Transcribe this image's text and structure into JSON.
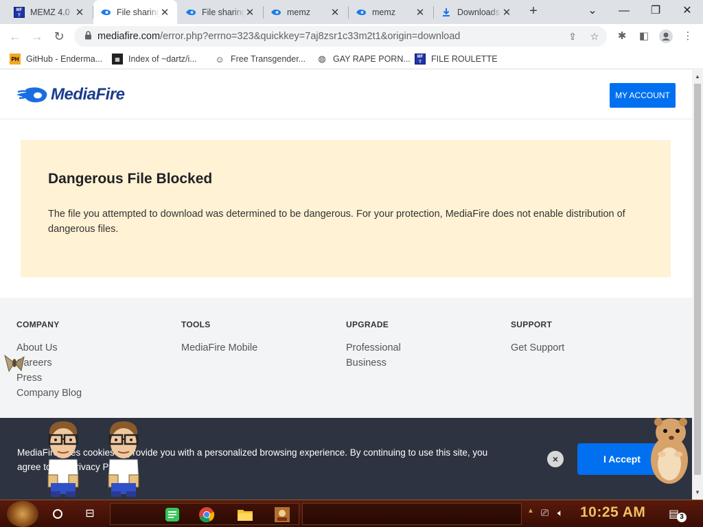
{
  "browser": {
    "tabs": [
      {
        "title": "MEMZ 4.0",
        "icon": "mf-icon"
      },
      {
        "title": "File sharing",
        "icon": "mediafire-flame-icon"
      },
      {
        "title": "File sharing",
        "icon": "mediafire-flame-icon"
      },
      {
        "title": "memz",
        "icon": "mediafire-flame-icon"
      },
      {
        "title": "memz",
        "icon": "mediafire-flame-icon"
      },
      {
        "title": "Downloads",
        "icon": "download-icon"
      }
    ],
    "url_domain": "mediafire.com",
    "url_path": "/error.php?errno=323&quickkey=7aj8zsr1c33m2t1&origin=download",
    "bookmarks": [
      {
        "label": "GitHub - Enderma...",
        "icon": "ph-icon"
      },
      {
        "label": "Index of ~dartz/i...",
        "icon": "pixel-icon"
      },
      {
        "label": "Free Transgender...",
        "icon": "mask-icon"
      },
      {
        "label": "GAY RAPE PORN...",
        "icon": "globe-icon"
      },
      {
        "label": "FILE ROULETTE",
        "icon": "mf-icon"
      }
    ]
  },
  "site": {
    "logo_text": "MediaFire",
    "my_account": "MY ACCOUNT",
    "alert": {
      "title": "Dangerous File Blocked",
      "text": "The file you attempted to download was determined to be dangerous. For your protection, MediaFire does not enable distribution of dangerous files."
    },
    "footer": {
      "company": {
        "heading": "COMPANY",
        "links": [
          "About Us",
          "Careers",
          "Press",
          "Company Blog"
        ]
      },
      "tools": {
        "heading": "TOOLS",
        "links": [
          "MediaFire Mobile"
        ]
      },
      "upgrade": {
        "heading": "UPGRADE",
        "links": [
          "Professional",
          "Business"
        ]
      },
      "support": {
        "heading": "SUPPORT",
        "links": [
          "Get Support"
        ]
      }
    },
    "cookie": {
      "text": "MediaFire uses cookies to provide you with a personalized browsing experience. By continuing to use this site, you agree to our Privacy Policy.",
      "accept": "I Accept",
      "close": "×"
    }
  },
  "taskbar": {
    "clock": "10:25 AM",
    "notifications": "3"
  },
  "colors": {
    "brand_blue": "#0070f0",
    "logo_navy": "#1c3d8c",
    "alert_bg": "#fff2d5",
    "cookie_bg": "#2d3340"
  }
}
